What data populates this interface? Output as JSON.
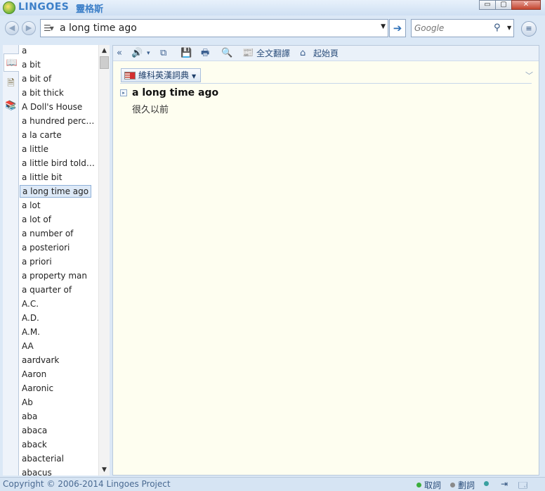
{
  "app": {
    "name": "LINGOES",
    "name_cjk": "靈格斯"
  },
  "window_controls": {
    "minimize_glyph": "▭",
    "maximize_glyph": "▢",
    "close_glyph": "✕"
  },
  "toolbar": {
    "back_glyph": "◀",
    "forward_glyph": "▶",
    "search_value": "a long time ago",
    "go_glyph": "➔",
    "google_placeholder": "Google",
    "search_icon": "search-icon",
    "menu_glyph": "≡"
  },
  "left_tabs": [
    {
      "icon": "dictionary-book-icon",
      "glyph": "📖"
    },
    {
      "icon": "translate-doc-icon",
      "glyph": "🗎"
    },
    {
      "icon": "glossary-icon",
      "glyph": "📚"
    }
  ],
  "word_list": {
    "selected": "a long time ago",
    "items": [
      "a",
      "a bit",
      "a bit of",
      "a bit thick",
      "A Doll's House",
      "a hundred perce...",
      "a la carte",
      "a little",
      "a little bird told ...",
      "a little bit",
      "a long time ago",
      "a lot",
      "a lot of",
      "a number of",
      "a posteriori",
      "a priori",
      "a property man",
      "a quarter of",
      "A.C.",
      "A.D.",
      "A.M.",
      "AA",
      "aardvark",
      "Aaron",
      "Aaronic",
      "Ab",
      "aba",
      "abaca",
      "aback",
      "abacterial",
      "abacus"
    ]
  },
  "result_toolbar": {
    "collapse_glyph": "«",
    "speaker_glyph": "🔊",
    "dropdown_glyph": "▾",
    "copy_glyph": "⧉",
    "save_glyph": "💾",
    "print_glyph": "🖶",
    "find_glyph": "🔍",
    "full_text_translate_label": "全文翻譯",
    "home_label": "起始頁"
  },
  "dictionary": {
    "name": "維科英漢詞典",
    "entry": {
      "headword": "a long time ago",
      "definition": "很久以前"
    }
  },
  "status": {
    "copyright": "Copyright © 2006-2014 Lingoes Project",
    "fetch_label": "取詞",
    "select_label": "劃詞",
    "colors": {
      "fetch_dot": "#3cae3c",
      "select_dot": "#8a8a8a",
      "third_dot": "#3aa0a0"
    }
  }
}
